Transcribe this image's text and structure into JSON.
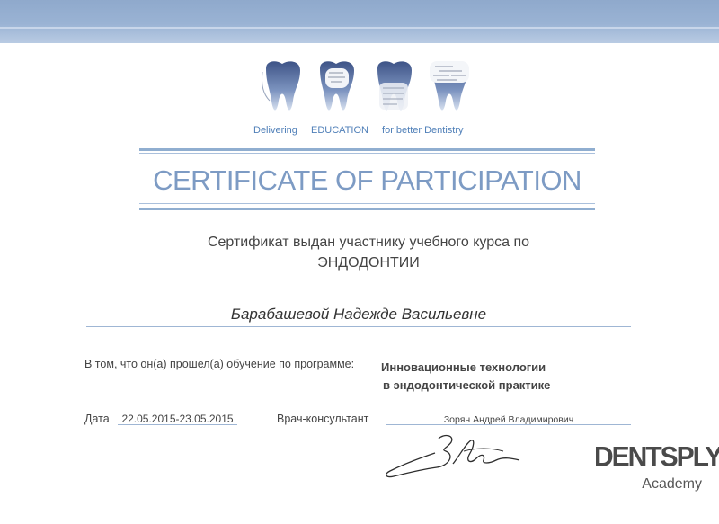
{
  "header": {
    "tagline": [
      "Delivering",
      "EDUCATION",
      "for better Dentistry"
    ]
  },
  "certificate": {
    "title": "CERTIFICATE OF PARTICIPATION",
    "issued_text": "Сертификат выдан участнику учебного курса по",
    "course": "ЭНДОДОНТИИ",
    "recipient": "Барабашевой Надежде Васильевне",
    "program_label": "В том, что он(а) прошел(а) обучение по программе:",
    "program_line1": "Инновационные технологии",
    "program_line2": "в эндодонтической практике",
    "date_label": "Дата",
    "date_value": "22.05.2015-23.05.2015",
    "doctor_label": "Врач-консультант",
    "doctor_value": "Зорян Андрей Владимирович"
  },
  "brand": {
    "name": "DENTSPLY",
    "sub": "Academy"
  },
  "colors": {
    "accent": "#7d9bc4",
    "band": "#9ab3d4",
    "tagline": "#4f7fb8",
    "tooth": "#5a6f9c"
  },
  "icons": [
    "tooth-icon",
    "tooth-icon",
    "tooth-icon",
    "tooth-icon",
    "signature"
  ]
}
